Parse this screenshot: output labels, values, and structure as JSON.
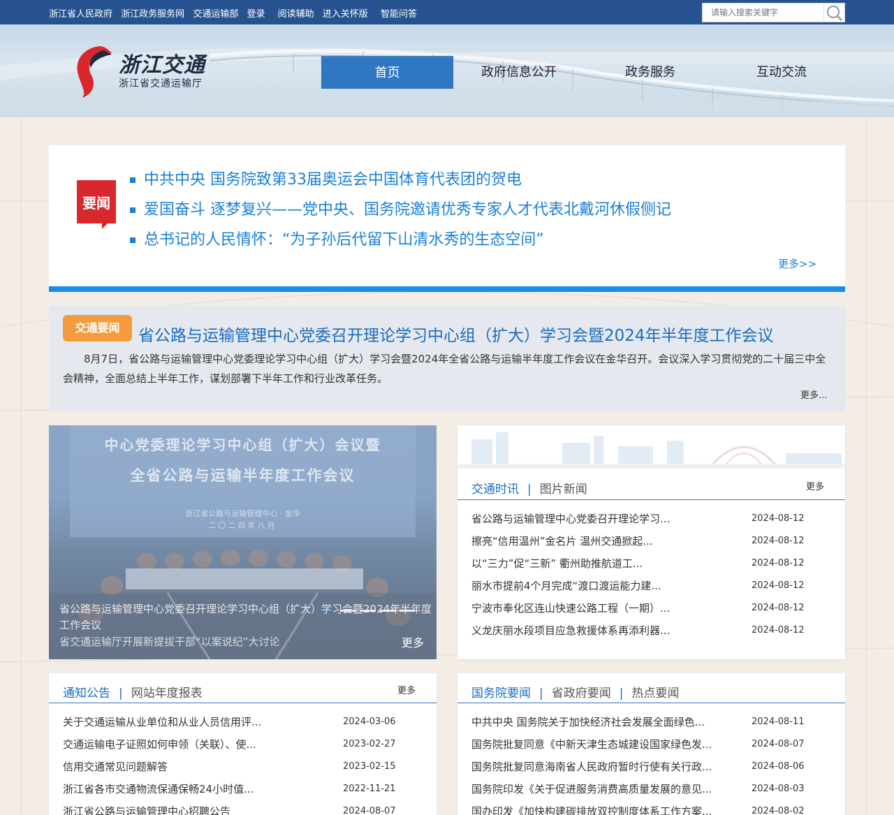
{
  "topbar": {
    "links": [
      "浙江省人民政府",
      "浙江政务服务网",
      "交通运输部",
      "登录",
      "阅读辅助",
      "进入关怀版",
      "智能问答"
    ],
    "search_placeholder": "请输入搜索关键字"
  },
  "header": {
    "logo_title": "浙江交通",
    "logo_sub": "浙江省交通运输厅",
    "nav": [
      "首页",
      "政府信息公开",
      "政务服务",
      "互动交流"
    ]
  },
  "headlines": {
    "badge": "要闻",
    "items": [
      "中共中央 国务院致第33届奥运会中国体育代表团的贺电",
      "爱国奋斗 逐梦复兴——党中央、国务院邀请优秀专家人才代表北戴河休假侧记",
      "总书记的人民情怀：“为子孙后代留下山清水秀的生态空间”"
    ],
    "more": "更多>>"
  },
  "traffic_news": {
    "badge": "交通要闻",
    "title": "省公路与运输管理中心党委召开理论学习中心组（扩大）学习会暨2024年半年度工作会议",
    "desc": "8月7日，省公路与运输管理中心党委理论学习中心组（扩大）学习会暨2024年全省公路与运输半年度工作会议在金华召开。会议深入学习贯彻党的二十届三中全会精神，全面总结上半年工作，谋划部署下半年工作和行业改革任务。",
    "more": "更多..."
  },
  "carousel": {
    "banner_line1": "中心党委理论学习中心组（扩大）会议暨",
    "banner_line2": "全省公路与运输半年度工作会议",
    "banner_line3": "浙江省公路与运输管理中心 · 金华",
    "banner_line4": "二〇二四年八月",
    "caption": "省公路与运输管理中心党委召开理论学习中心组（扩大）学习会暨2024年半年度工作会议",
    "caption2": "省交通运输厅开展新提拔干部“以案说纪”大讨论",
    "more": "更多"
  },
  "panel_traffic": {
    "tabs": [
      "交通时讯",
      "图片新闻"
    ],
    "more": "更多",
    "items": [
      {
        "title": "省公路与运输管理中心党委召开理论学习...",
        "date": "2024-08-12"
      },
      {
        "title": "擦亮“信用温州”金名片 温州交通掀起...",
        "date": "2024-08-12"
      },
      {
        "title": "以“三力”促“三新” 衢州助推航道工...",
        "date": "2024-08-12"
      },
      {
        "title": "丽水市提前4个月完成“渡口渡运能力建...",
        "date": "2024-08-12"
      },
      {
        "title": "宁波市奉化区连山快速公路工程（一期）...",
        "date": "2024-08-12"
      },
      {
        "title": "义龙庆丽水段项目应急救援体系再添利器...",
        "date": "2024-08-12"
      }
    ]
  },
  "panel_notice": {
    "tabs": [
      "通知公告",
      "网站年度报表"
    ],
    "more": "更多",
    "items": [
      {
        "title": "关于交通运输从业单位和从业人员信用评...",
        "date": "2024-03-06"
      },
      {
        "title": "交通运输电子证照如何申领（关联）、使...",
        "date": "2023-02-27"
      },
      {
        "title": "信用交通常见问题解答",
        "date": "2023-02-15"
      },
      {
        "title": "浙江省各市交通物流保通保畅24小时值...",
        "date": "2022-11-21"
      },
      {
        "title": "浙江省公路与运输管理中心招聘公告",
        "date": "2024-08-07"
      }
    ]
  },
  "panel_state": {
    "tabs": [
      "国务院要闻",
      "省政府要闻",
      "热点要闻"
    ],
    "items": [
      {
        "title": "中共中央 国务院关于加快经济社会发展全面绿色...",
        "date": "2024-08-11"
      },
      {
        "title": "国务院批复同意《中新天津生态城建设国家绿色发...",
        "date": "2024-08-07"
      },
      {
        "title": "国务院批复同意海南省人民政府暂时行使有关行政...",
        "date": "2024-08-06"
      },
      {
        "title": "国务院印发《关于促进服务消费高质量发展的意见...",
        "date": "2024-08-03"
      },
      {
        "title": "国办印发《加快构建碳排放双控制度体系工作方案...",
        "date": "2024-08-02"
      }
    ]
  },
  "colors": {
    "topbar": "#26538f",
    "nav_active": "#2f77c2",
    "link_blue": "#1a7fd5",
    "badge_red": "#d9272e",
    "badge_orange": "#f49b3d"
  }
}
